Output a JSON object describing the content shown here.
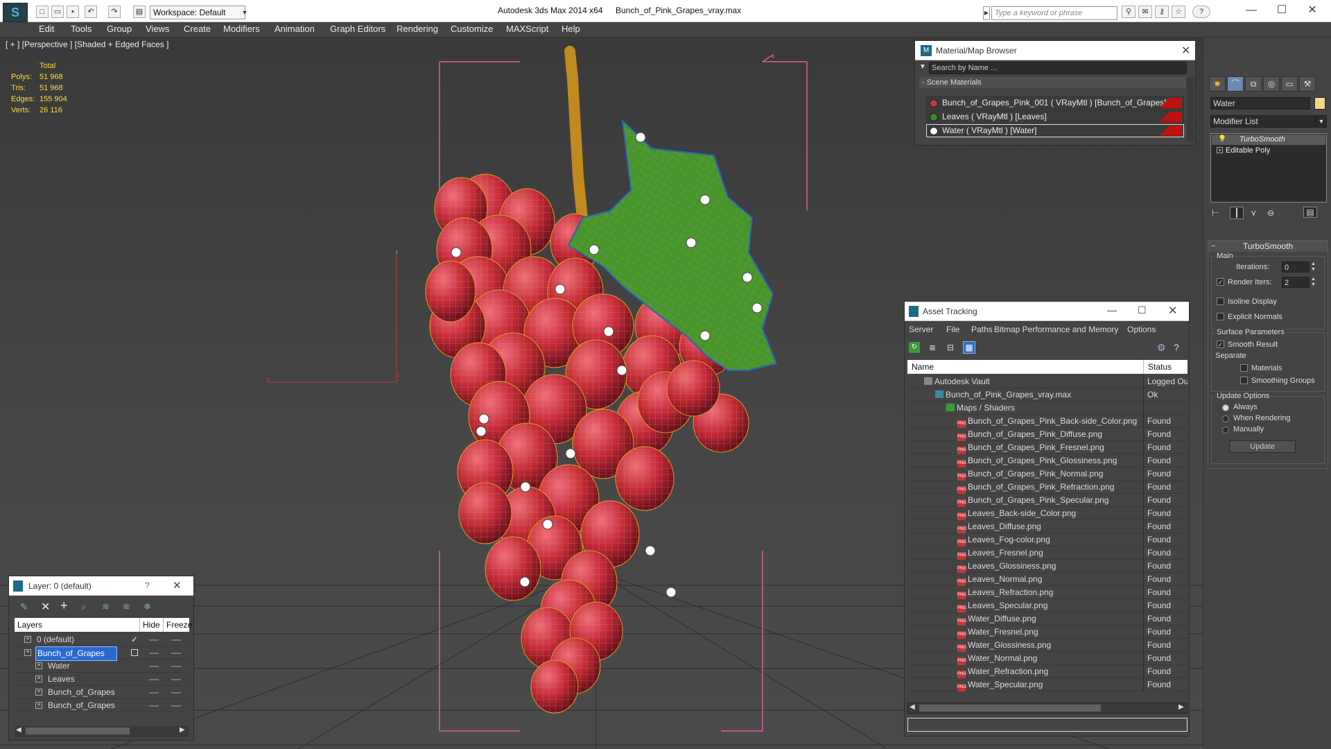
{
  "app": {
    "title": "Autodesk 3ds Max  2014 x64",
    "file": "Bunch_of_Pink_Grapes_vray.max",
    "logo": "3ds-max-logo",
    "workspace": "Workspace: Default",
    "search_placeholder": "Type a keyword or phrase"
  },
  "menu": [
    "Edit",
    "Tools",
    "Group",
    "Views",
    "Create",
    "Modifiers",
    "Animation",
    "Graph Editors",
    "Rendering",
    "Customize",
    "MAXScript",
    "Help"
  ],
  "viewport": {
    "label": "[ + ] [Perspective ] [Shaded + Edged Faces ]",
    "stats_header": "Total",
    "stats": [
      {
        "label": "Polys:",
        "value": "51 968"
      },
      {
        "label": "Tris:",
        "value": "51 968"
      },
      {
        "label": "Edges:",
        "value": "155 904"
      },
      {
        "label": "Verts:",
        "value": "26 116"
      }
    ],
    "axis_z": "z",
    "axis_y": "y",
    "axis_x": "x"
  },
  "material_browser": {
    "title": "Material/Map Browser",
    "search_placeholder": "Search by Name ...",
    "section": "- Scene Materials",
    "items": [
      {
        "label": "Bunch_of_Grapes_Pink_001  ( VRayMtl )  [Bunch_of_Grapes]",
        "color": "#c23a3a"
      },
      {
        "label": "Leaves  ( VRayMtl )  [Leaves]",
        "color": "#3d8a2a"
      },
      {
        "label": "Water  ( VRayMtl )  [Water]",
        "color": "#ffffff"
      }
    ]
  },
  "asset_tracking": {
    "title": "Asset Tracking",
    "menu": [
      "Server",
      "File",
      "Paths",
      "Bitmap Performance and Memory",
      "Options"
    ],
    "col_name": "Name",
    "col_status": "Status",
    "rows": [
      {
        "name": "Autodesk Vault",
        "status": "Logged Ou",
        "indent": 1,
        "icon": "vault-icon"
      },
      {
        "name": "Bunch_of_Pink_Grapes_vray.max",
        "status": "Ok",
        "indent": 2,
        "icon": "max-file-icon"
      },
      {
        "name": "Maps / Shaders",
        "status": "",
        "indent": 3,
        "icon": "maps-icon"
      },
      {
        "name": "Bunch_of_Grapes_Pink_Back-side_Color.png",
        "status": "Found",
        "indent": 4,
        "icon": "png-icon"
      },
      {
        "name": "Bunch_of_Grapes_Pink_Diffuse.png",
        "status": "Found",
        "indent": 4,
        "icon": "png-icon"
      },
      {
        "name": "Bunch_of_Grapes_Pink_Fresnel.png",
        "status": "Found",
        "indent": 4,
        "icon": "png-icon"
      },
      {
        "name": "Bunch_of_Grapes_Pink_Glossiness.png",
        "status": "Found",
        "indent": 4,
        "icon": "png-icon"
      },
      {
        "name": "Bunch_of_Grapes_Pink_Normal.png",
        "status": "Found",
        "indent": 4,
        "icon": "png-icon"
      },
      {
        "name": "Bunch_of_Grapes_Pink_Refraction.png",
        "status": "Found",
        "indent": 4,
        "icon": "png-icon"
      },
      {
        "name": "Bunch_of_Grapes_Pink_Specular.png",
        "status": "Found",
        "indent": 4,
        "icon": "png-icon"
      },
      {
        "name": "Leaves_Back-side_Color.png",
        "status": "Found",
        "indent": 4,
        "icon": "png-icon"
      },
      {
        "name": "Leaves_Diffuse.png",
        "status": "Found",
        "indent": 4,
        "icon": "png-icon"
      },
      {
        "name": "Leaves_Fog-color.png",
        "status": "Found",
        "indent": 4,
        "icon": "png-icon"
      },
      {
        "name": "Leaves_Fresnel.png",
        "status": "Found",
        "indent": 4,
        "icon": "png-icon"
      },
      {
        "name": "Leaves_Glossiness.png",
        "status": "Found",
        "indent": 4,
        "icon": "png-icon"
      },
      {
        "name": "Leaves_Normal.png",
        "status": "Found",
        "indent": 4,
        "icon": "png-icon"
      },
      {
        "name": "Leaves_Refraction.png",
        "status": "Found",
        "indent": 4,
        "icon": "png-icon"
      },
      {
        "name": "Leaves_Specular.png",
        "status": "Found",
        "indent": 4,
        "icon": "png-icon"
      },
      {
        "name": "Water_Diffuse.png",
        "status": "Found",
        "indent": 4,
        "icon": "png-icon"
      },
      {
        "name": "Water_Fresnel.png",
        "status": "Found",
        "indent": 4,
        "icon": "png-icon"
      },
      {
        "name": "Water_Glossiness.png",
        "status": "Found",
        "indent": 4,
        "icon": "png-icon"
      },
      {
        "name": "Water_Normal.png",
        "status": "Found",
        "indent": 4,
        "icon": "png-icon"
      },
      {
        "name": "Water_Refraction.png",
        "status": "Found",
        "indent": 4,
        "icon": "png-icon"
      },
      {
        "name": "Water_Specular.png",
        "status": "Found",
        "indent": 4,
        "icon": "png-icon"
      }
    ],
    "png_badge": "PNG"
  },
  "layer_window": {
    "title": "Layer: 0 (default)",
    "help": "?",
    "col_layers": "Layers",
    "col_hide": "Hide",
    "col_freeze": "Freeze",
    "rows": [
      {
        "name": "0 (default)",
        "indent": 1,
        "selected": false,
        "check": "✓"
      },
      {
        "name": "Bunch_of_Grapes",
        "indent": 1,
        "selected": true,
        "check": ""
      },
      {
        "name": "Water",
        "indent": 2,
        "selected": false,
        "check": ""
      },
      {
        "name": "Leaves",
        "indent": 2,
        "selected": false,
        "check": ""
      },
      {
        "name": "Bunch_of_Grapes",
        "indent": 2,
        "selected": false,
        "check": ""
      },
      {
        "name": "Bunch_of_Grapes",
        "indent": 2,
        "selected": false,
        "check": ""
      }
    ]
  },
  "command_panel": {
    "object_name": "Water",
    "object_color": "#f2d98a",
    "modifier_list": "Modifier List",
    "stack": [
      "TurboSmooth",
      "Editable Poly"
    ],
    "rollout_title": "TurboSmooth",
    "main_group": "Main",
    "iterations_label": "Iterations:",
    "iterations_value": "0",
    "render_iters_label": "Render Iters:",
    "render_iters_value": "2",
    "render_iters_checked": "✓",
    "isoline": "Isoline Display",
    "explicit_normals": "Explicit Normals",
    "surface_group": "Surface Parameters",
    "smooth_result": "Smooth Result",
    "smooth_checked": "✓",
    "separate": "Separate",
    "materials": "Materials",
    "smoothing_groups": "Smoothing Groups",
    "update_group": "Update Options",
    "always": "Always",
    "when_rendering": "When Rendering",
    "manually": "Manually",
    "update_button": "Update"
  }
}
